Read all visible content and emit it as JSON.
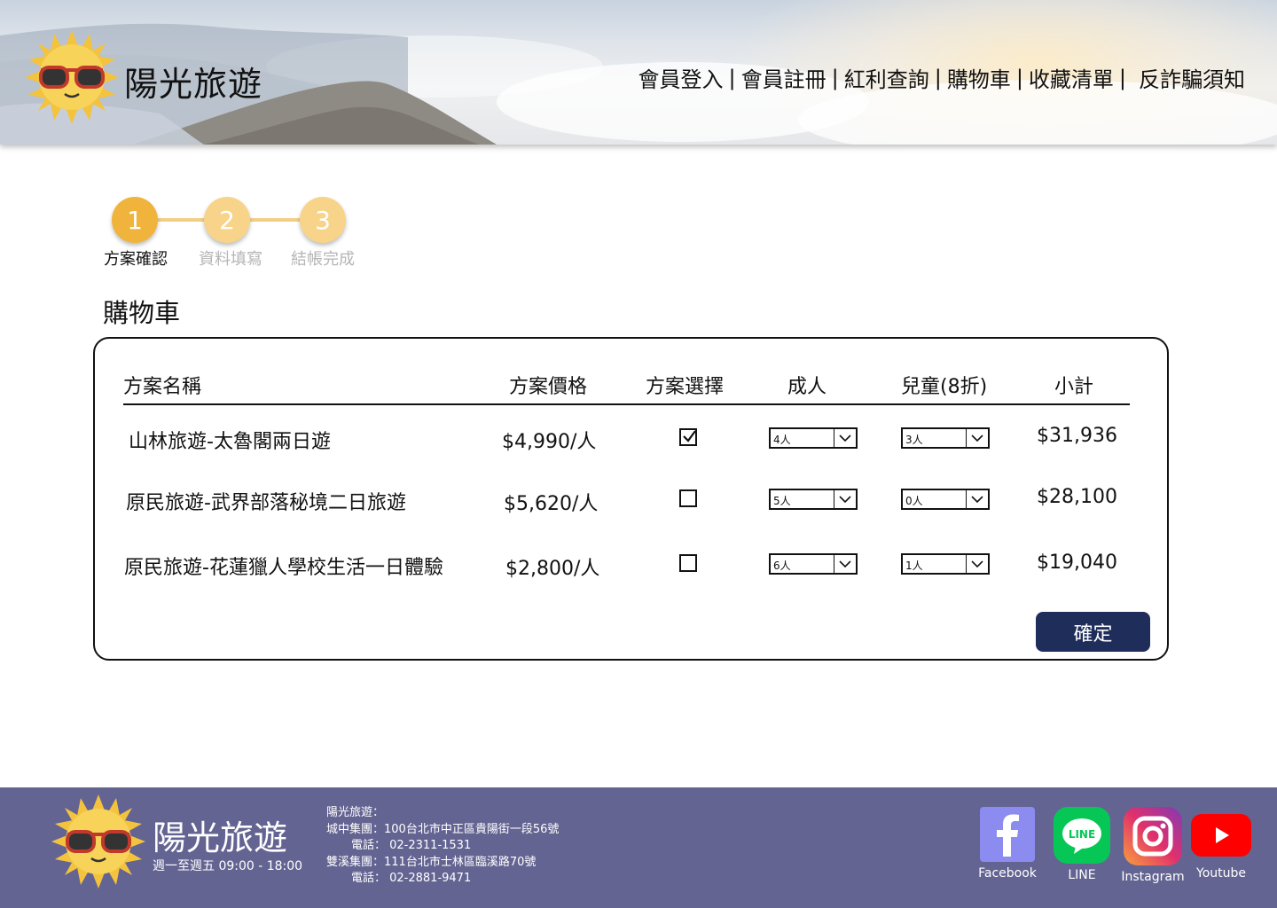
{
  "brand": {
    "name": "陽光旅遊"
  },
  "nav": {
    "links": [
      "會員登入",
      "會員註冊",
      "紅利查詢",
      "購物車",
      "收藏清單",
      "反詐騙須知"
    ],
    "separator": "|"
  },
  "steps": [
    {
      "number": "1",
      "label": "方案確認",
      "state": "active"
    },
    {
      "number": "2",
      "label": "資料填寫",
      "state": "pending"
    },
    {
      "number": "3",
      "label": "結帳完成",
      "state": "pending"
    }
  ],
  "page": {
    "title": "購物車"
  },
  "cart": {
    "headers": {
      "name": "方案名稱",
      "price": "方案價格",
      "select": "方案選擇",
      "adult": "成人",
      "child": "兒童(8折)",
      "subtotal": "小計"
    },
    "rows": [
      {
        "name": "山林旅遊-太魯閣兩日遊",
        "price": "$4,990/人",
        "selected": true,
        "adult": "4人",
        "child": "3人",
        "subtotal": "$31,936"
      },
      {
        "name": "原民旅遊-武界部落秘境二日旅遊",
        "price": "$5,620/人",
        "selected": false,
        "adult": "5人",
        "child": "0人",
        "subtotal": "$28,100"
      },
      {
        "name": "原民旅遊-花蓮獵人學校生活一日體驗",
        "price": "$2,800/人",
        "selected": false,
        "adult": "6人",
        "child": "1人",
        "subtotal": "$19,040"
      }
    ],
    "confirm_label": "確定"
  },
  "footer": {
    "brand_name": "陽光旅遊",
    "hours": "週一至週五 09:00 - 18:00",
    "info_title": "陽光旅遊：",
    "branch1": "城中集團：100台北市中正區貴陽街一段56號",
    "branch1_phone": "電話： 02-2311-1531",
    "branch2": "雙溪集團：111台北市士林區臨溪路70號",
    "branch2_phone": "電話： 02-2881-9471",
    "social": [
      {
        "name": "Facebook",
        "icon": "facebook-icon",
        "color": "#8c8cf0"
      },
      {
        "name": "LINE",
        "icon": "line-icon",
        "color": "#06c755"
      },
      {
        "name": "Instagram",
        "icon": "instagram-icon",
        "color": "#c13584"
      },
      {
        "name": "Youtube",
        "icon": "youtube-icon",
        "color": "#ff0000"
      }
    ]
  },
  "colors": {
    "accent": "#f0b43c",
    "accent_light": "#f7d48a",
    "button": "#1e2d5a",
    "footer_bg": "#646493"
  }
}
